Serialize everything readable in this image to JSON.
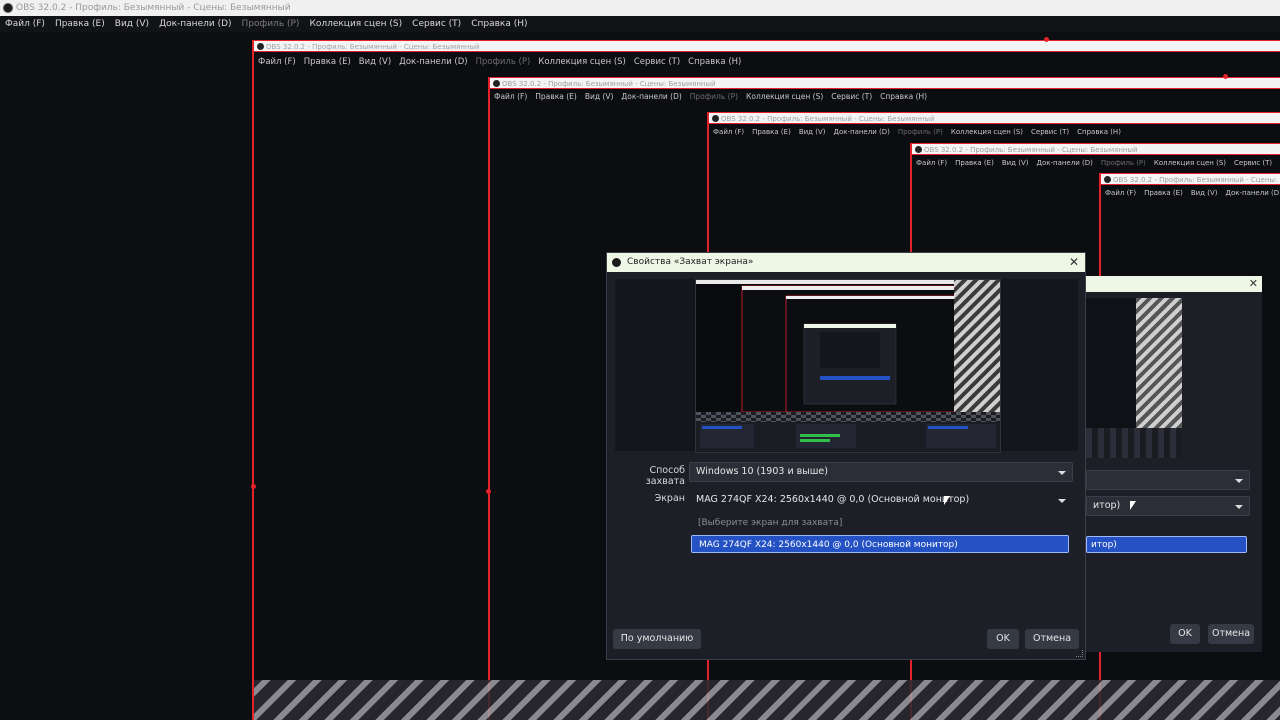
{
  "app": {
    "window_title": "OBS 32.0.2 - Профиль: Безымянный - Сцены: Безымянный",
    "menu": [
      {
        "label": "Файл (F)",
        "enabled": true
      },
      {
        "label": "Правка (E)",
        "enabled": true
      },
      {
        "label": "Вид (V)",
        "enabled": true
      },
      {
        "label": "Док-панели (D)",
        "enabled": true
      },
      {
        "label": "Профиль (P)",
        "enabled": false
      },
      {
        "label": "Коллекция сцен (S)",
        "enabled": true
      },
      {
        "label": "Сервис (T)",
        "enabled": true
      },
      {
        "label": "Справка (H)",
        "enabled": true
      }
    ]
  },
  "dialog": {
    "title": "Свойства «Захват экрана»",
    "close_glyph": "✕",
    "capture_method": {
      "label": "Способ захвата",
      "value": "Windows 10 (1903 и выше)"
    },
    "screen": {
      "label": "Экран",
      "value": "MAG 274QF X24: 2560x1440 @ 0,0 (Основной монитор)",
      "options": [
        "[Выберите экран для захвата]",
        "MAG 274QF X24: 2560x1440 @ 0,0 (Основной монитор)"
      ]
    },
    "buttons": {
      "defaults": "По умолчанию",
      "ok": "OK",
      "cancel": "Отмена"
    }
  },
  "ghost_dialog": {
    "close_glyph": "✕",
    "screen_value_fragment": "итор)",
    "selected_fragment": "итор)",
    "ok": "OK",
    "cancel": "Отмена"
  },
  "colors": {
    "accent": "#2451c4",
    "capture_border": "#e3222c"
  }
}
